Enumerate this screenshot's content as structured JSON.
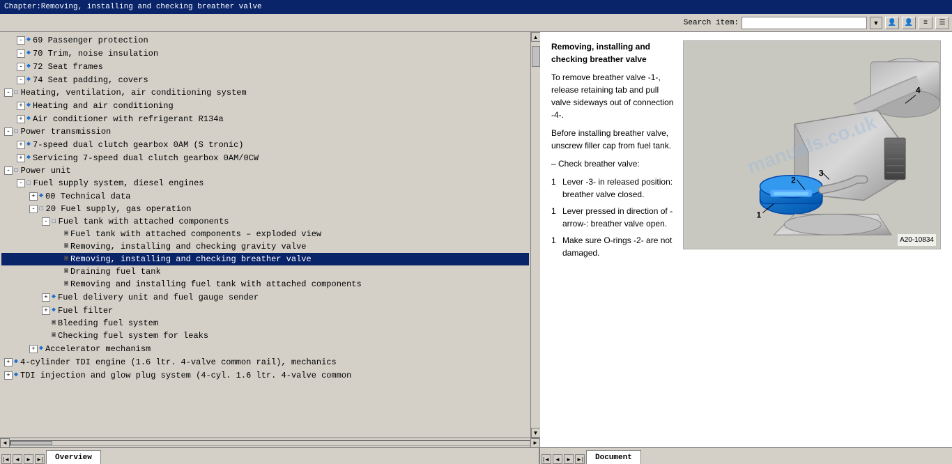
{
  "titleBar": {
    "text": "Chapter:Removing, installing and checking breather valve"
  },
  "toolbar": {
    "searchLabel": "Search item:",
    "searchPlaceholder": ""
  },
  "tree": {
    "items": [
      {
        "id": 1,
        "indent": 1,
        "type": "expandable",
        "expanded": true,
        "icon": "blue-diamond",
        "label": "69 Passenger protection"
      },
      {
        "id": 2,
        "indent": 1,
        "type": "expandable",
        "expanded": true,
        "icon": "blue-diamond",
        "label": "70 Trim, noise insulation"
      },
      {
        "id": 3,
        "indent": 1,
        "type": "expandable",
        "expanded": true,
        "icon": "blue-diamond",
        "label": "72 Seat frames"
      },
      {
        "id": 4,
        "indent": 1,
        "type": "expandable",
        "expanded": true,
        "icon": "blue-diamond",
        "label": "74 Seat padding, covers"
      },
      {
        "id": 5,
        "indent": 0,
        "type": "folder",
        "expanded": true,
        "icon": "folder",
        "label": "Heating, ventilation, air conditioning system"
      },
      {
        "id": 6,
        "indent": 1,
        "type": "expandable",
        "expanded": false,
        "icon": "blue-diamond",
        "label": "Heating and air conditioning"
      },
      {
        "id": 7,
        "indent": 1,
        "type": "expandable",
        "expanded": false,
        "icon": "blue-diamond",
        "label": "Air conditioner with refrigerant R134a"
      },
      {
        "id": 8,
        "indent": 0,
        "type": "folder",
        "expanded": true,
        "icon": "folder",
        "label": "Power transmission"
      },
      {
        "id": 9,
        "indent": 1,
        "type": "expandable",
        "expanded": false,
        "icon": "blue-diamond",
        "label": "7-speed dual clutch gearbox 0AM (S tronic)"
      },
      {
        "id": 10,
        "indent": 1,
        "type": "expandable",
        "expanded": false,
        "icon": "blue-diamond",
        "label": "Servicing 7-speed dual clutch gearbox 0AM/0CW"
      },
      {
        "id": 11,
        "indent": 0,
        "type": "folder",
        "expanded": true,
        "icon": "folder",
        "label": "Power unit"
      },
      {
        "id": 12,
        "indent": 1,
        "type": "folder",
        "expanded": true,
        "icon": "folder",
        "label": "Fuel supply system, diesel engines"
      },
      {
        "id": 13,
        "indent": 2,
        "type": "expandable",
        "expanded": false,
        "icon": "blue-diamond",
        "label": "00 Technical data"
      },
      {
        "id": 14,
        "indent": 2,
        "type": "folder",
        "expanded": true,
        "icon": "folder",
        "label": "20 Fuel supply, gas operation"
      },
      {
        "id": 15,
        "indent": 3,
        "type": "folder",
        "expanded": true,
        "icon": "folder",
        "label": "Fuel tank with attached components"
      },
      {
        "id": 16,
        "indent": 4,
        "type": "page",
        "label": "Fuel tank with attached components – exploded view"
      },
      {
        "id": 17,
        "indent": 4,
        "type": "page",
        "label": "Removing, installing and checking gravity valve"
      },
      {
        "id": 18,
        "indent": 4,
        "type": "page",
        "label": "Removing, installing and checking breather valve",
        "selected": true
      },
      {
        "id": 19,
        "indent": 4,
        "type": "page",
        "label": "Draining fuel tank"
      },
      {
        "id": 20,
        "indent": 4,
        "type": "page",
        "label": "Removing and installing fuel tank with attached components"
      },
      {
        "id": 21,
        "indent": 3,
        "type": "expandable",
        "expanded": false,
        "icon": "blue-diamond",
        "label": "Fuel delivery unit and fuel gauge sender"
      },
      {
        "id": 22,
        "indent": 3,
        "type": "expandable",
        "expanded": false,
        "icon": "blue-diamond",
        "label": "Fuel filter"
      },
      {
        "id": 23,
        "indent": 3,
        "type": "page",
        "label": "Bleeding fuel system"
      },
      {
        "id": 24,
        "indent": 3,
        "type": "page",
        "label": "Checking fuel system for leaks"
      },
      {
        "id": 25,
        "indent": 2,
        "type": "expandable",
        "expanded": false,
        "icon": "blue-diamond",
        "label": "Accelerator mechanism"
      },
      {
        "id": 26,
        "indent": 0,
        "type": "expandable",
        "expanded": false,
        "icon": "blue-diamond",
        "label": "4-cylinder TDI engine (1.6 ltr. 4-valve common rail), mechanics"
      },
      {
        "id": 27,
        "indent": 0,
        "type": "expandable",
        "expanded": false,
        "icon": "blue-diamond",
        "label": "TDI injection and glow plug system (4-cyl. 1.6 ltr. 4-valve common"
      }
    ]
  },
  "document": {
    "title": "Removing, installing and checking breather valve",
    "sections": [
      {
        "type": "para",
        "text": "To remove breather valve -1-, release retaining tab and pull valve sideways out of connection -4-."
      },
      {
        "type": "para",
        "text": "Before installing breather valve, unscrew filler cap from fuel tank."
      },
      {
        "type": "bullet",
        "prefix": "–",
        "text": "Check breather valve:"
      },
      {
        "type": "step",
        "num": "1",
        "text": "Lever -3- in released position: breather valve closed."
      },
      {
        "type": "step",
        "num": "1",
        "text": "Lever pressed in direction of -arrow-: breather valve open."
      },
      {
        "type": "step",
        "num": "1",
        "text": "Make sure O-rings -2- are not damaged."
      }
    ],
    "imageLabel": "A20-10834",
    "watermark": "manuals.co.uk"
  },
  "bottomTabs": {
    "left": {
      "tabs": [
        "Overview"
      ]
    },
    "right": {
      "tabs": [
        "Document"
      ]
    }
  },
  "icons": {
    "expand": "+",
    "collapse": "-",
    "navLeft": "◄",
    "navRight": "►",
    "scrollUp": "▲",
    "scrollDown": "▼",
    "scrollLeft": "◄",
    "scrollRight": "►"
  }
}
